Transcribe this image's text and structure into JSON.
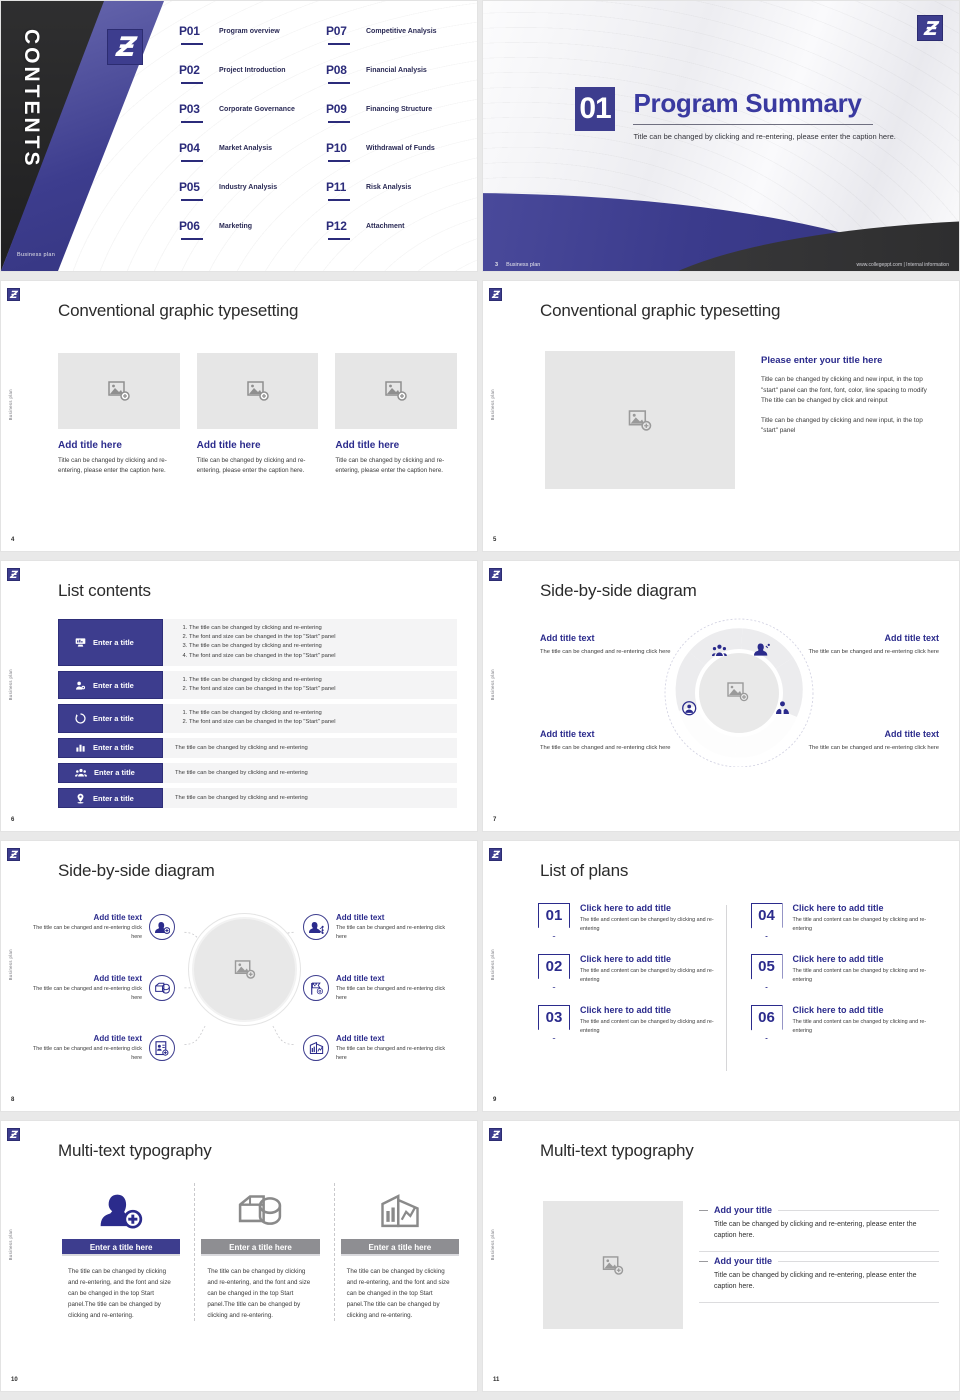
{
  "brand": {
    "accent_navy": "#2b2b8c",
    "accent_purple": "#3d3d8e",
    "dark": "#2f2f30",
    "placeholder_gray": "#e6e6e6"
  },
  "slides": [
    {
      "id": "contents",
      "side_word": "CONTENTS",
      "footer_left": "Business plan",
      "toc": [
        {
          "num": "P01",
          "title": "Program overview"
        },
        {
          "num": "P07",
          "title": "Competitive Analysis"
        },
        {
          "num": "P02",
          "title": "Project Introduction"
        },
        {
          "num": "P08",
          "title": "Financial Analysis"
        },
        {
          "num": "P03",
          "title": "Corporate Governance"
        },
        {
          "num": "P09",
          "title": "Financing Structure"
        },
        {
          "num": "P04",
          "title": "Market Analysis"
        },
        {
          "num": "P10",
          "title": "Withdrawal of Funds"
        },
        {
          "num": "P05",
          "title": "Industry Analysis"
        },
        {
          "num": "P11",
          "title": "Risk Analysis"
        },
        {
          "num": "P06",
          "title": "Marketing"
        },
        {
          "num": "P12",
          "title": "Attachment"
        }
      ]
    },
    {
      "id": "summary",
      "number": "01",
      "title": "Program Summary",
      "subtitle": "Title can be changed by clicking and re-entering, please enter the caption here.",
      "footer_page": "3",
      "footer_label": "Business plan",
      "footer_right": "www.collegeppt.com  |  Internal information"
    },
    {
      "id": "graphic-three",
      "page": "4",
      "side_label": "Business plan",
      "title": "Conventional graphic typesetting",
      "cards": [
        {
          "heading": "Add title here",
          "body": "Title can be changed by clicking and re-entering, please enter the caption here."
        },
        {
          "heading": "Add title here",
          "body": "Title can be changed by clicking and re-entering, please enter the caption here."
        },
        {
          "heading": "Add title here",
          "body": "Title can be changed by clicking and re-entering, please enter the caption here."
        }
      ]
    },
    {
      "id": "graphic-one",
      "page": "5",
      "side_label": "Business plan",
      "title": "Conventional graphic typesetting",
      "heading": "Please enter your title here",
      "para1": "Title can be changed by clicking and new input, in the top \"start\" panel can the font, font, color, line spacing to modify The title can be changed by click and reinput",
      "para2": "Title can be changed by clicking and new input, in the top \"start\" panel"
    },
    {
      "id": "list-contents",
      "page": "6",
      "side_label": "Business plan",
      "title": "List contents",
      "rows": [
        {
          "icon": "presentation-chart-icon",
          "tab": "Enter a title",
          "items": [
            "The title can be changed by clicking and re-entering",
            "The font and size can be changed in the top \"Start\" panel",
            "The title can be changed by clicking and re-entering",
            "The font and size can be changed in the top \"Start\" panel"
          ]
        },
        {
          "icon": "user-settings-icon",
          "tab": "Enter a title",
          "items": [
            "The title can be changed by clicking and re-entering",
            "The font and size can be changed in the top \"Start\" panel"
          ]
        },
        {
          "icon": "recycle-icon",
          "tab": "Enter a title",
          "items": [
            "The title can be changed by clicking and re-entering",
            "The font and size can be changed in the top \"Start\" panel"
          ]
        },
        {
          "icon": "bar-chart-icon",
          "tab": "Enter a title",
          "plain": "The title can be changed by clicking and re-entering"
        },
        {
          "icon": "group-users-icon",
          "tab": "Enter a title",
          "plain": "The title can be changed by clicking and re-entering"
        },
        {
          "icon": "location-pin-icon",
          "tab": "Enter a title",
          "plain": "The title can be changed by clicking and re-entering"
        }
      ]
    },
    {
      "id": "side-by-side-donut",
      "page": "7",
      "side_label": "Business plan",
      "title": "Side-by-side diagram",
      "blocks": [
        {
          "heading": "Add title text",
          "body": "The title can be changed and re-entering click here"
        },
        {
          "heading": "Add title text",
          "body": "The title can be changed and re-entering click here"
        },
        {
          "heading": "Add title text",
          "body": "The title can be changed and re-entering click here"
        },
        {
          "heading": "Add title text",
          "body": "The title can be changed and re-entering click here"
        }
      ]
    },
    {
      "id": "side-by-side-six",
      "page": "8",
      "side_label": "Business plan",
      "title": "Side-by-side diagram",
      "items": [
        {
          "icon": "add-user-icon",
          "heading": "Add title text",
          "body": "The title can be changed and re-entering click here"
        },
        {
          "icon": "package-box-icon",
          "heading": "Add title text",
          "body": "The title can be changed and re-entering click here"
        },
        {
          "icon": "id-card-icon",
          "heading": "Add title text",
          "body": "The title can be changed and re-entering click here"
        },
        {
          "icon": "user-network-icon",
          "heading": "Add title text",
          "body": "The title can be changed and re-entering click here"
        },
        {
          "icon": "flag-target-icon",
          "heading": "Add title text",
          "body": "The title can be changed and re-entering click here"
        },
        {
          "icon": "building-chart-icon",
          "heading": "Add title text",
          "body": "The title can be changed and re-entering click here"
        }
      ]
    },
    {
      "id": "list-of-plans",
      "page": "9",
      "side_label": "Business plan",
      "title": "List of plans",
      "items": [
        {
          "num": "01",
          "heading": "Click here to add title",
          "body": "The title and content can be changed by clicking and re-entering"
        },
        {
          "num": "02",
          "heading": "Click here to add title",
          "body": "The title and content can be changed by clicking and re-entering"
        },
        {
          "num": "03",
          "heading": "Click here to add title",
          "body": "The title and content can be changed by clicking and re-entering"
        },
        {
          "num": "04",
          "heading": "Click here to add title",
          "body": "The title and content can be changed by clicking and re-entering"
        },
        {
          "num": "05",
          "heading": "Click here to add title",
          "body": "The title and content can be changed by clicking and re-entering"
        },
        {
          "num": "06",
          "heading": "Click here to add title",
          "body": "The title and content can be changed by clicking and re-entering"
        }
      ]
    },
    {
      "id": "multi-text-three",
      "page": "10",
      "side_label": "Business plan",
      "title": "Multi-text typography",
      "columns": [
        {
          "icon": "add-user-icon",
          "bar": "Enter a title here",
          "style": "primary",
          "body": "The title can be changed by clicking and re-entering, and the font and size can be changed in the top Start panel.The title can be changed by clicking and re-entering."
        },
        {
          "icon": "package-box-icon",
          "bar": "Enter a title here",
          "style": "muted",
          "body": "The title can be changed by clicking and re-entering, and the font and size can be changed in the top Start panel.The title can be changed by clicking and re-entering."
        },
        {
          "icon": "building-chart-icon",
          "bar": "Enter a title here",
          "style": "muted",
          "body": "The title can be changed by clicking and re-entering, and the font and size can be changed in the top Start panel.The title can be changed by clicking and re-entering."
        }
      ]
    },
    {
      "id": "multi-text-image",
      "page": "11",
      "side_label": "Business plan",
      "title": "Multi-text typography",
      "blocks": [
        {
          "heading": "Add your title",
          "body": "Title can be changed by clicking and re-entering, please enter the caption here."
        },
        {
          "heading": "Add your title",
          "body": "Title can be changed by clicking and re-entering, please enter the caption here."
        }
      ]
    }
  ]
}
